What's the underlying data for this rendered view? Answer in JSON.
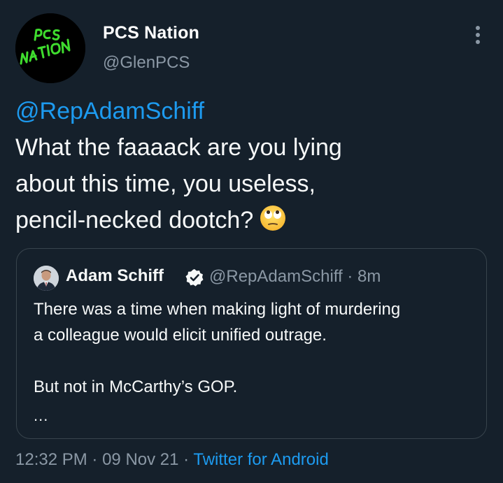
{
  "author": {
    "display_name": "PCS Nation",
    "handle": "@GlenPCS",
    "avatar_text": "PCS NATION",
    "avatar_text_color": "#3fdc2e"
  },
  "tweet": {
    "mention": "@RepAdamSchiff",
    "lines": [
      "What the faaaack are you lying",
      "about this time, you useless,",
      "pencil-necked dootch?"
    ],
    "emoji": "face-with-rolling-eyes-icon"
  },
  "quote": {
    "display_name": "Adam Schiff",
    "verified": true,
    "handle_time": "@RepAdamSchiff · 8m",
    "lines": [
      "There was a time when making light of murdering",
      "a colleague would elicit unified outrage."
    ],
    "line_after_gap": "But not in McCarthy’s GOP.",
    "ellipsis": "..."
  },
  "footer": {
    "time": "12:32 PM",
    "separator": "·",
    "date": "09 Nov 21",
    "source": "Twitter for Android"
  },
  "colors": {
    "background": "#15202b",
    "accent": "#1d9bf0",
    "secondary_text": "#8b98a5",
    "border": "#38444d"
  }
}
